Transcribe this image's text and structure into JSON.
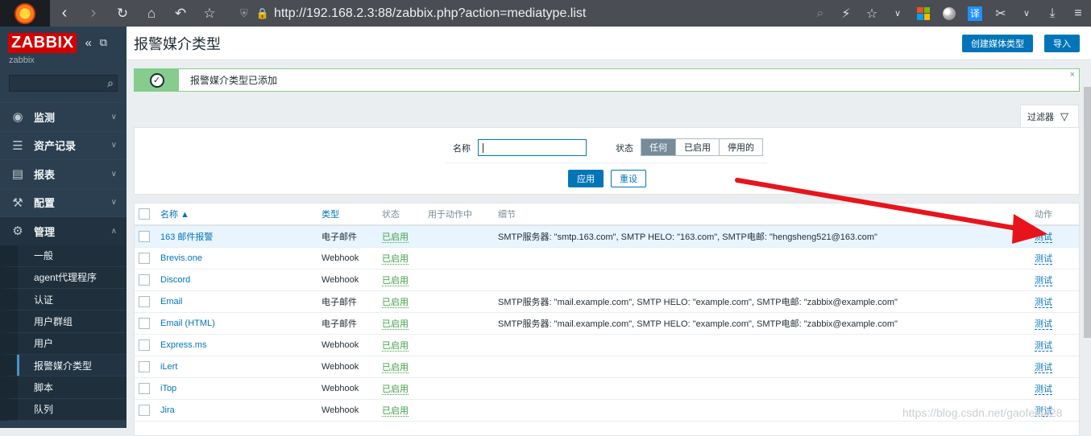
{
  "browser": {
    "url": "http://192.168.2.3:88/zabbix.php?action=mediatype.list",
    "translate_label": "译"
  },
  "sidebar": {
    "logo": "ZABBIX",
    "server_name": "zabbix",
    "menu": [
      {
        "label": "监测",
        "icon": "eye-icon"
      },
      {
        "label": "资产记录",
        "icon": "list-icon"
      },
      {
        "label": "报表",
        "icon": "chart-icon"
      },
      {
        "label": "配置",
        "icon": "wrench-icon"
      },
      {
        "label": "管理",
        "icon": "gear-icon"
      }
    ],
    "submenu": [
      "一般",
      "agent代理程序",
      "认证",
      "用户群组",
      "用户",
      "报警媒介类型",
      "脚本",
      "队列"
    ]
  },
  "header": {
    "title": "报警媒介类型",
    "create_button": "创建媒体类型",
    "import_button": "导入"
  },
  "message": {
    "text": "报警媒介类型已添加",
    "close": "×"
  },
  "filter": {
    "tab_label": "过滤器",
    "name_label": "名称",
    "name_value": "",
    "status_label": "状态",
    "status_options": [
      "任何",
      "已启用",
      "停用的"
    ],
    "status_selected": "任何",
    "apply": "应用",
    "reset": "重设"
  },
  "table": {
    "headers": [
      "名称 ▲",
      "类型",
      "状态",
      "用于动作中",
      "细节",
      "动作"
    ],
    "rows": [
      {
        "name": "163 邮件报警",
        "type": "电子邮件",
        "status": "已启用",
        "actions": "",
        "details": "SMTP服务器: \"smtp.163.com\", SMTP HELO: \"163.com\", SMTP电邮: \"hengsheng521@163.com\"",
        "action": "测试"
      },
      {
        "name": "Brevis.one",
        "type": "Webhook",
        "status": "已启用",
        "actions": "",
        "details": "",
        "action": "测试"
      },
      {
        "name": "Discord",
        "type": "Webhook",
        "status": "已启用",
        "actions": "",
        "details": "",
        "action": "测试"
      },
      {
        "name": "Email",
        "type": "电子邮件",
        "status": "已启用",
        "actions": "",
        "details": "SMTP服务器: \"mail.example.com\", SMTP HELO: \"example.com\", SMTP电邮: \"zabbix@example.com\"",
        "action": "测试"
      },
      {
        "name": "Email (HTML)",
        "type": "电子邮件",
        "status": "已启用",
        "actions": "",
        "details": "SMTP服务器: \"mail.example.com\", SMTP HELO: \"example.com\", SMTP电邮: \"zabbix@example.com\"",
        "action": "测试"
      },
      {
        "name": "Express.ms",
        "type": "Webhook",
        "status": "已启用",
        "actions": "",
        "details": "",
        "action": "测试"
      },
      {
        "name": "iLert",
        "type": "Webhook",
        "status": "已启用",
        "actions": "",
        "details": "",
        "action": "测试"
      },
      {
        "name": "iTop",
        "type": "Webhook",
        "status": "已启用",
        "actions": "",
        "details": "",
        "action": "测试"
      },
      {
        "name": "Jira",
        "type": "Webhook",
        "status": "已启用",
        "actions": "",
        "details": "",
        "action": "测试"
      }
    ]
  },
  "watermark": "https://blog.csdn.net/gaofei0428",
  "colors": {
    "accent": "#0275b8",
    "enabled": "#429e47",
    "sidebar": "#2b3f50",
    "annotation_arrow": "#e8141b"
  }
}
